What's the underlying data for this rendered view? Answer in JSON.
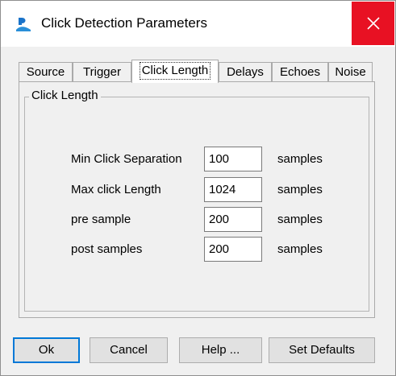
{
  "window": {
    "title": "Click Detection Parameters",
    "app_icon": "pamguard-icon",
    "close_glyph": "✕"
  },
  "tabs": [
    {
      "label": "Source",
      "active": false
    },
    {
      "label": "Trigger",
      "active": false
    },
    {
      "label": "Click Length",
      "active": true
    },
    {
      "label": "Delays",
      "active": false
    },
    {
      "label": "Echoes",
      "active": false
    },
    {
      "label": "Noise",
      "active": false
    }
  ],
  "group": {
    "title": "Click Length",
    "params": [
      {
        "label": "Min Click Separation",
        "value": "100",
        "unit": "samples"
      },
      {
        "label": "Max click Length",
        "value": "1024",
        "unit": "samples"
      },
      {
        "label": "pre sample",
        "value": "200",
        "unit": "samples"
      },
      {
        "label": "post samples",
        "value": "200",
        "unit": "samples"
      }
    ]
  },
  "buttons": {
    "ok": "Ok",
    "cancel": "Cancel",
    "help": "Help ...",
    "set_defaults": "Set Defaults"
  },
  "colors": {
    "close_button": "#e81123",
    "focus_border": "#0078d7",
    "icon_blue": "#1a73c9"
  }
}
